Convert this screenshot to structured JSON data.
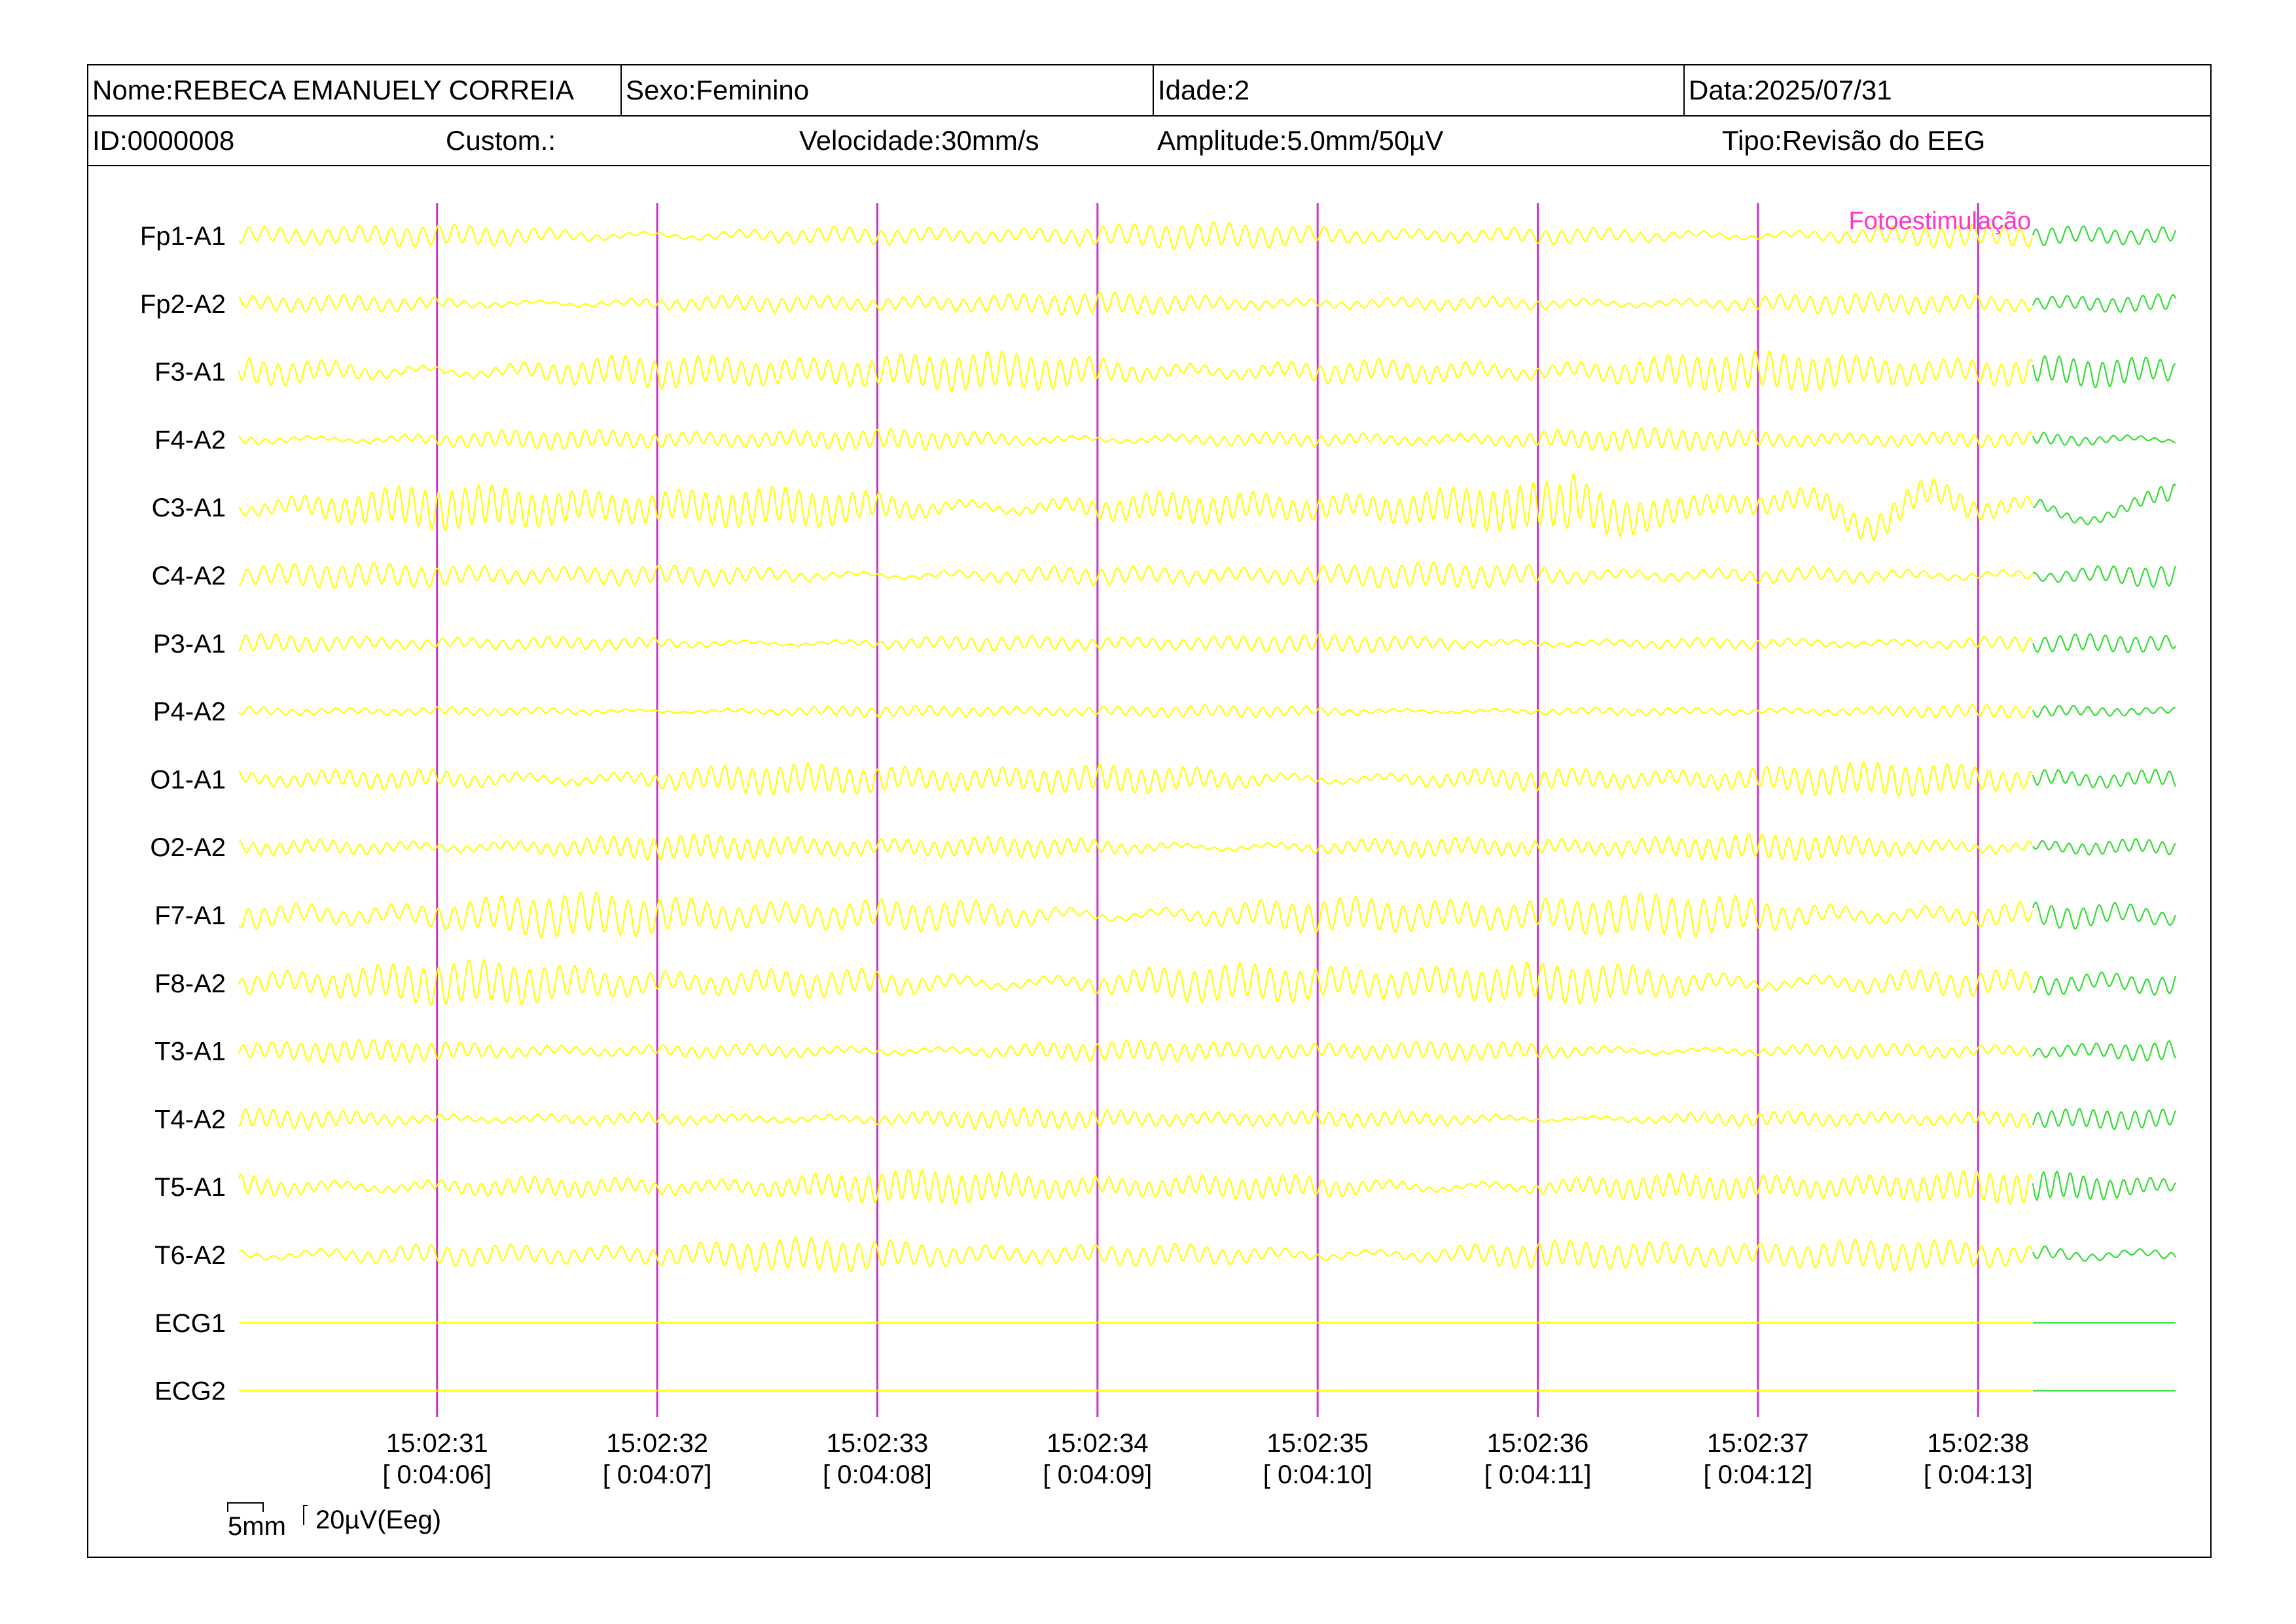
{
  "header": {
    "name": "Nome:REBECA EMANUELY CORREIA",
    "sex": "Sexo:Feminino",
    "age": "Idade:2",
    "date": "Data:2025/07/31",
    "id": "ID:0000008",
    "custom": "Custom.:",
    "speed": "Velocidade:30mm/s",
    "amplitude": "Amplitude:5.0mm/50µV",
    "type": "Tipo:Revisão do EEG"
  },
  "colors": {
    "trace_primary": "#ffff00",
    "trace_after_event": "#33dd33",
    "marker_line": "#cc33cc",
    "event_label": "#ff33cc"
  },
  "chart_data": {
    "type": "line",
    "title": "",
    "xlabel": "",
    "ylabel": "",
    "grid": false,
    "channels": [
      "Fp1-A1",
      "Fp2-A2",
      "F3-A1",
      "F4-A2",
      "C3-A1",
      "C4-A2",
      "P3-A1",
      "P4-A2",
      "O1-A1",
      "O2-A2",
      "F7-A1",
      "F8-A2",
      "T3-A1",
      "T4-A2",
      "T5-A1",
      "T6-A2",
      "ECG1",
      "ECG2"
    ],
    "time_ticks": [
      {
        "clock": "15:02:31",
        "elapsed": "[ 0:04:06]"
      },
      {
        "clock": "15:02:32",
        "elapsed": "[ 0:04:07]"
      },
      {
        "clock": "15:02:33",
        "elapsed": "[ 0:04:08]"
      },
      {
        "clock": "15:02:34",
        "elapsed": "[ 0:04:09]"
      },
      {
        "clock": "15:02:35",
        "elapsed": "[ 0:04:10]"
      },
      {
        "clock": "15:02:36",
        "elapsed": "[ 0:04:11]"
      },
      {
        "clock": "15:02:37",
        "elapsed": "[ 0:04:12]"
      },
      {
        "clock": "15:02:38",
        "elapsed": "[ 0:04:13]"
      }
    ],
    "x_range_seconds": [
      -0.9,
      7.9
    ],
    "event": {
      "label": "Fotoestimulação",
      "time_seconds": 7.25
    },
    "scale_bar": {
      "time": "5mm",
      "amplitude": "20µV(Eeg)"
    }
  }
}
